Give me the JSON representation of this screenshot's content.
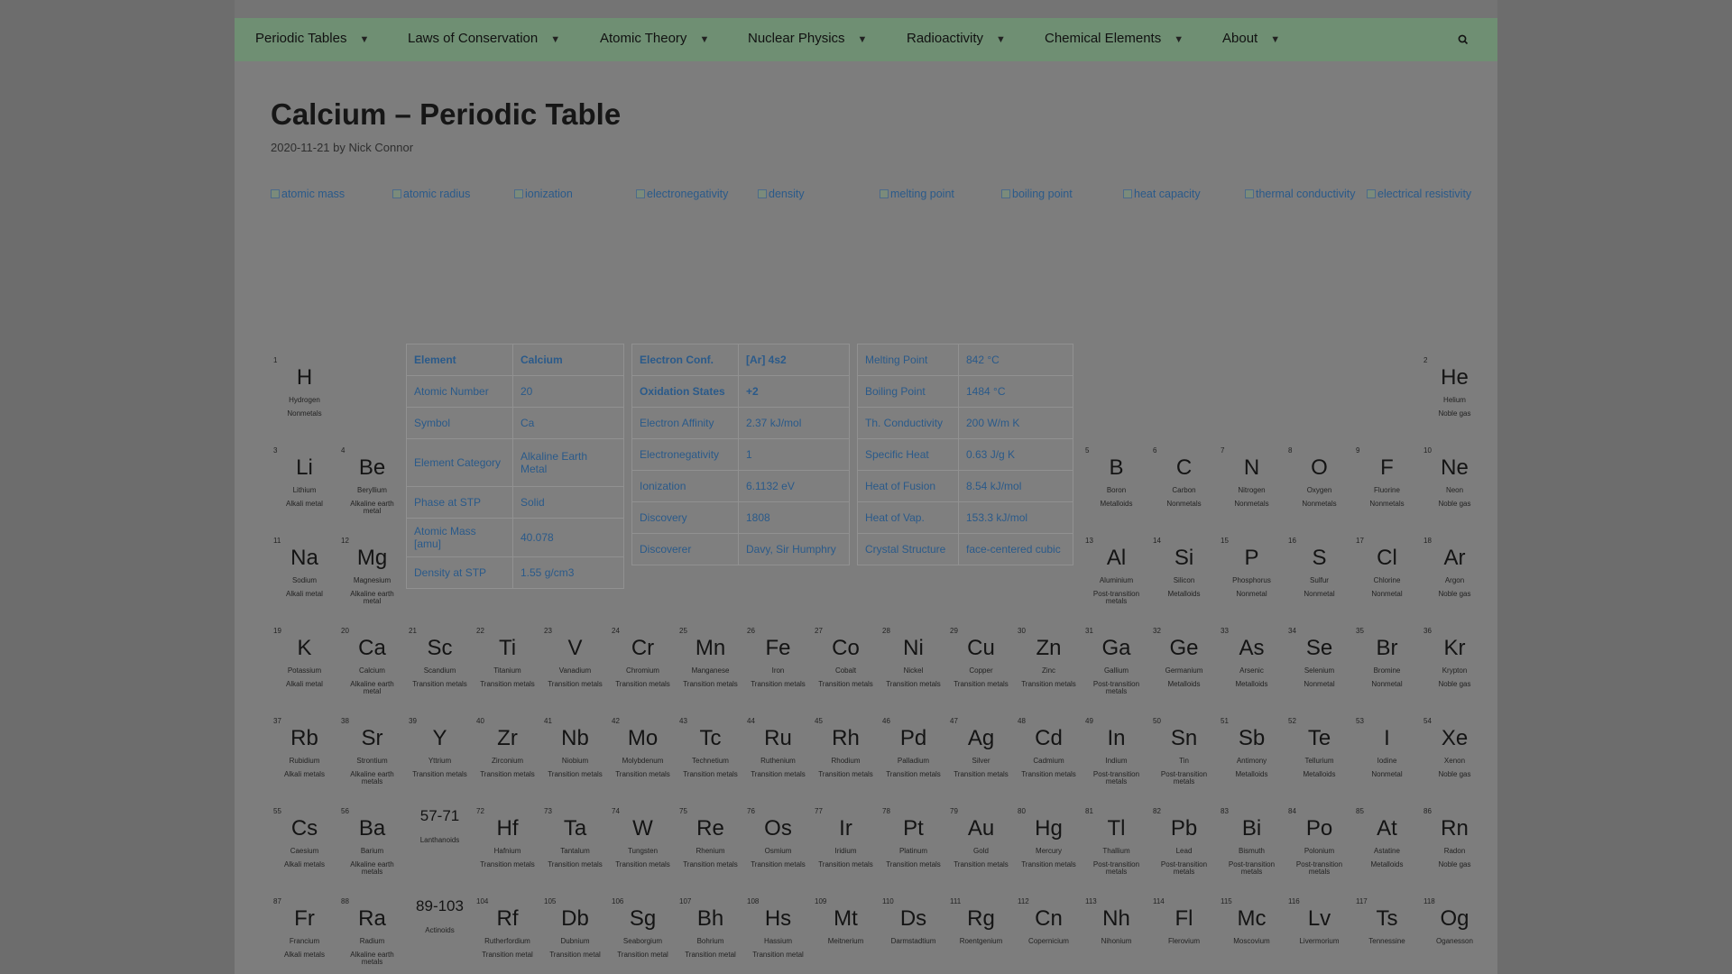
{
  "nav": {
    "items": [
      {
        "label": "Periodic Tables"
      },
      {
        "label": "Laws of Conservation"
      },
      {
        "label": "Atomic Theory"
      },
      {
        "label": "Nuclear Physics"
      },
      {
        "label": "Radioactivity"
      },
      {
        "label": "Chemical Elements"
      },
      {
        "label": "About"
      }
    ],
    "caret_icon": "chevron-down-icon",
    "search_icon": "search-icon"
  },
  "page": {
    "title": "Calcium – Periodic Table",
    "date": "2020-11-21",
    "by": "by",
    "author": "Nick Connor"
  },
  "property_images": [
    "atomic mass",
    "atomic radius",
    "ionization",
    "electronegativity",
    "density",
    "melting point",
    "boiling point",
    "heat capacity",
    "thermal conductivity",
    "electrical resistivity"
  ],
  "tables": [
    [
      [
        "Element",
        "Calcium"
      ],
      [
        "Atomic Number",
        "20"
      ],
      [
        "Symbol",
        "Ca"
      ],
      [
        "Element Category",
        "Alkaline Earth Metal"
      ],
      [
        "Phase at STP",
        "Solid"
      ],
      [
        "Atomic Mass [amu]",
        "40.078"
      ],
      [
        "Density at STP",
        "1.55 g/cm3"
      ]
    ],
    [
      [
        "Electron Conf.",
        "[Ar] 4s2"
      ],
      [
        "Oxidation States",
        "+2"
      ],
      [
        "Electron Affinity",
        "2.37 kJ/mol"
      ],
      [
        "Electronegativity",
        "1"
      ],
      [
        "Ionization",
        "6.1132 eV"
      ],
      [
        "Discovery",
        "1808"
      ],
      [
        "Discoverer",
        "Davy, Sir Humphry"
      ]
    ],
    [
      [
        "Melting Point",
        "842 °C"
      ],
      [
        "Boiling Point",
        "1484 °C"
      ],
      [
        "Th. Conductivity",
        "200 W/m K"
      ],
      [
        "Specific Heat",
        "0.63 J/g K"
      ],
      [
        "Heat of Fusion",
        "8.54 kJ/mol"
      ],
      [
        "Heat of Vap.",
        "153.3 kJ/mol"
      ],
      [
        "Crystal Structure",
        "face-centered cubic"
      ]
    ]
  ],
  "elements": [
    {
      "n": "1",
      "s": "H",
      "name": "Hydrogen",
      "cat": "Nonmetals",
      "row": 1,
      "col": 1
    },
    {
      "n": "2",
      "s": "He",
      "name": "Helium",
      "cat": "Noble gas",
      "row": 1,
      "col": 18
    },
    {
      "n": "3",
      "s": "Li",
      "name": "Lithium",
      "cat": "Alkali metal",
      "row": 2,
      "col": 1
    },
    {
      "n": "4",
      "s": "Be",
      "name": "Beryllium",
      "cat": "Alkaline earth metal",
      "row": 2,
      "col": 2
    },
    {
      "n": "5",
      "s": "B",
      "name": "Boron",
      "cat": "Metalloids",
      "row": 2,
      "col": 13
    },
    {
      "n": "6",
      "s": "C",
      "name": "Carbon",
      "cat": "Nonmetals",
      "row": 2,
      "col": 14
    },
    {
      "n": "7",
      "s": "N",
      "name": "Nitrogen",
      "cat": "Nonmetals",
      "row": 2,
      "col": 15
    },
    {
      "n": "8",
      "s": "O",
      "name": "Oxygen",
      "cat": "Nonmetals",
      "row": 2,
      "col": 16
    },
    {
      "n": "9",
      "s": "F",
      "name": "Fluorine",
      "cat": "Nonmetals",
      "row": 2,
      "col": 17
    },
    {
      "n": "10",
      "s": "Ne",
      "name": "Neon",
      "cat": "Noble gas",
      "row": 2,
      "col": 18
    },
    {
      "n": "11",
      "s": "Na",
      "name": "Sodium",
      "cat": "Alkali metal",
      "row": 3,
      "col": 1
    },
    {
      "n": "12",
      "s": "Mg",
      "name": "Magnesium",
      "cat": "Alkaline earth metal",
      "row": 3,
      "col": 2
    },
    {
      "n": "13",
      "s": "Al",
      "name": "Aluminium",
      "cat": "Post-transition metals",
      "row": 3,
      "col": 13
    },
    {
      "n": "14",
      "s": "Si",
      "name": "Silicon",
      "cat": "Metalloids",
      "row": 3,
      "col": 14
    },
    {
      "n": "15",
      "s": "P",
      "name": "Phosphorus",
      "cat": "Nonmetal",
      "row": 3,
      "col": 15
    },
    {
      "n": "16",
      "s": "S",
      "name": "Sulfur",
      "cat": "Nonmetal",
      "row": 3,
      "col": 16
    },
    {
      "n": "17",
      "s": "Cl",
      "name": "Chlorine",
      "cat": "Nonmetal",
      "row": 3,
      "col": 17
    },
    {
      "n": "18",
      "s": "Ar",
      "name": "Argon",
      "cat": "Noble gas",
      "row": 3,
      "col": 18
    },
    {
      "n": "19",
      "s": "K",
      "name": "Potassium",
      "cat": "Alkali metal",
      "row": 4,
      "col": 1
    },
    {
      "n": "20",
      "s": "Ca",
      "name": "Calcium",
      "cat": "Alkaline earth metal",
      "row": 4,
      "col": 2
    },
    {
      "n": "21",
      "s": "Sc",
      "name": "Scandium",
      "cat": "Transition metals",
      "row": 4,
      "col": 3
    },
    {
      "n": "22",
      "s": "Ti",
      "name": "Titanium",
      "cat": "Transition metals",
      "row": 4,
      "col": 4
    },
    {
      "n": "23",
      "s": "V",
      "name": "Vanadium",
      "cat": "Transition metals",
      "row": 4,
      "col": 5
    },
    {
      "n": "24",
      "s": "Cr",
      "name": "Chromium",
      "cat": "Transition metals",
      "row": 4,
      "col": 6
    },
    {
      "n": "25",
      "s": "Mn",
      "name": "Manganese",
      "cat": "Transition metals",
      "row": 4,
      "col": 7
    },
    {
      "n": "26",
      "s": "Fe",
      "name": "Iron",
      "cat": "Transition metals",
      "row": 4,
      "col": 8
    },
    {
      "n": "27",
      "s": "Co",
      "name": "Cobalt",
      "cat": "Transition metals",
      "row": 4,
      "col": 9
    },
    {
      "n": "28",
      "s": "Ni",
      "name": "Nickel",
      "cat": "Transition metals",
      "row": 4,
      "col": 10
    },
    {
      "n": "29",
      "s": "Cu",
      "name": "Copper",
      "cat": "Transition metals",
      "row": 4,
      "col": 11
    },
    {
      "n": "30",
      "s": "Zn",
      "name": "Zinc",
      "cat": "Transition metals",
      "row": 4,
      "col": 12
    },
    {
      "n": "31",
      "s": "Ga",
      "name": "Gallium",
      "cat": "Post-transition metals",
      "row": 4,
      "col": 13
    },
    {
      "n": "32",
      "s": "Ge",
      "name": "Germanium",
      "cat": "Metalloids",
      "row": 4,
      "col": 14
    },
    {
      "n": "33",
      "s": "As",
      "name": "Arsenic",
      "cat": "Metalloids",
      "row": 4,
      "col": 15
    },
    {
      "n": "34",
      "s": "Se",
      "name": "Selenium",
      "cat": "Nonmetal",
      "row": 4,
      "col": 16
    },
    {
      "n": "35",
      "s": "Br",
      "name": "Bromine",
      "cat": "Nonmetal",
      "row": 4,
      "col": 17
    },
    {
      "n": "36",
      "s": "Kr",
      "name": "Krypton",
      "cat": "Noble gas",
      "row": 4,
      "col": 18
    },
    {
      "n": "37",
      "s": "Rb",
      "name": "Rubidium",
      "cat": "Alkali metals",
      "row": 5,
      "col": 1
    },
    {
      "n": "38",
      "s": "Sr",
      "name": "Strontium",
      "cat": "Alkaline earth metals",
      "row": 5,
      "col": 2
    },
    {
      "n": "39",
      "s": "Y",
      "name": "Yttrium",
      "cat": "Transition metals",
      "row": 5,
      "col": 3
    },
    {
      "n": "40",
      "s": "Zr",
      "name": "Zirconium",
      "cat": "Transition metals",
      "row": 5,
      "col": 4
    },
    {
      "n": "41",
      "s": "Nb",
      "name": "Niobium",
      "cat": "Transition metals",
      "row": 5,
      "col": 5
    },
    {
      "n": "42",
      "s": "Mo",
      "name": "Molybdenum",
      "cat": "Transition metals",
      "row": 5,
      "col": 6
    },
    {
      "n": "43",
      "s": "Tc",
      "name": "Technetium",
      "cat": "Transition metals",
      "row": 5,
      "col": 7
    },
    {
      "n": "44",
      "s": "Ru",
      "name": "Ruthenium",
      "cat": "Transition metals",
      "row": 5,
      "col": 8
    },
    {
      "n": "45",
      "s": "Rh",
      "name": "Rhodium",
      "cat": "Transition metals",
      "row": 5,
      "col": 9
    },
    {
      "n": "46",
      "s": "Pd",
      "name": "Palladium",
      "cat": "Transition metals",
      "row": 5,
      "col": 10
    },
    {
      "n": "47",
      "s": "Ag",
      "name": "Silver",
      "cat": "Transition metals",
      "row": 5,
      "col": 11
    },
    {
      "n": "48",
      "s": "Cd",
      "name": "Cadmium",
      "cat": "Transition metals",
      "row": 5,
      "col": 12
    },
    {
      "n": "49",
      "s": "In",
      "name": "Indium",
      "cat": "Post-transition metals",
      "row": 5,
      "col": 13
    },
    {
      "n": "50",
      "s": "Sn",
      "name": "Tin",
      "cat": "Post-transition metals",
      "row": 5,
      "col": 14
    },
    {
      "n": "51",
      "s": "Sb",
      "name": "Antimony",
      "cat": "Metalloids",
      "row": 5,
      "col": 15
    },
    {
      "n": "52",
      "s": "Te",
      "name": "Tellurium",
      "cat": "Metalloids",
      "row": 5,
      "col": 16
    },
    {
      "n": "53",
      "s": "I",
      "name": "Iodine",
      "cat": "Nonmetal",
      "row": 5,
      "col": 17
    },
    {
      "n": "54",
      "s": "Xe",
      "name": "Xenon",
      "cat": "Noble gas",
      "row": 5,
      "col": 18
    },
    {
      "n": "55",
      "s": "Cs",
      "name": "Caesium",
      "cat": "Alkali metals",
      "row": 6,
      "col": 1
    },
    {
      "n": "56",
      "s": "Ba",
      "name": "Barium",
      "cat": "Alkaline earth metals",
      "row": 6,
      "col": 2
    },
    {
      "n": "",
      "s": "57-71",
      "name": "Lanthanoids",
      "cat": "",
      "row": 6,
      "col": 3,
      "series": true
    },
    {
      "n": "72",
      "s": "Hf",
      "name": "Hafnium",
      "cat": "Transition metals",
      "row": 6,
      "col": 4
    },
    {
      "n": "73",
      "s": "Ta",
      "name": "Tantalum",
      "cat": "Transition metals",
      "row": 6,
      "col": 5
    },
    {
      "n": "74",
      "s": "W",
      "name": "Tungsten",
      "cat": "Transition metals",
      "row": 6,
      "col": 6
    },
    {
      "n": "75",
      "s": "Re",
      "name": "Rhenium",
      "cat": "Transition metals",
      "row": 6,
      "col": 7
    },
    {
      "n": "76",
      "s": "Os",
      "name": "Osmium",
      "cat": "Transition metals",
      "row": 6,
      "col": 8
    },
    {
      "n": "77",
      "s": "Ir",
      "name": "Iridium",
      "cat": "Transition metals",
      "row": 6,
      "col": 9
    },
    {
      "n": "78",
      "s": "Pt",
      "name": "Platinum",
      "cat": "Transition metals",
      "row": 6,
      "col": 10
    },
    {
      "n": "79",
      "s": "Au",
      "name": "Gold",
      "cat": "Transition metals",
      "row": 6,
      "col": 11
    },
    {
      "n": "80",
      "s": "Hg",
      "name": "Mercury",
      "cat": "Transition metals",
      "row": 6,
      "col": 12
    },
    {
      "n": "81",
      "s": "Tl",
      "name": "Thallium",
      "cat": "Post-transition metals",
      "row": 6,
      "col": 13
    },
    {
      "n": "82",
      "s": "Pb",
      "name": "Lead",
      "cat": "Post-transition metals",
      "row": 6,
      "col": 14
    },
    {
      "n": "83",
      "s": "Bi",
      "name": "Bismuth",
      "cat": "Post-transition metals",
      "row": 6,
      "col": 15
    },
    {
      "n": "84",
      "s": "Po",
      "name": "Polonium",
      "cat": "Post-transition metals",
      "row": 6,
      "col": 16
    },
    {
      "n": "85",
      "s": "At",
      "name": "Astatine",
      "cat": "Metalloids",
      "row": 6,
      "col": 17
    },
    {
      "n": "86",
      "s": "Rn",
      "name": "Radon",
      "cat": "Noble gas",
      "row": 6,
      "col": 18
    },
    {
      "n": "87",
      "s": "Fr",
      "name": "Francium",
      "cat": "Alkali metals",
      "row": 7,
      "col": 1
    },
    {
      "n": "88",
      "s": "Ra",
      "name": "Radium",
      "cat": "Alkaline earth metals",
      "row": 7,
      "col": 2
    },
    {
      "n": "",
      "s": "89-103",
      "name": "Actinoids",
      "cat": "",
      "row": 7,
      "col": 3,
      "series": true
    },
    {
      "n": "104",
      "s": "Rf",
      "name": "Rutherfordium",
      "cat": "Transition metal",
      "row": 7,
      "col": 4
    },
    {
      "n": "105",
      "s": "Db",
      "name": "Dubnium",
      "cat": "Transition metal",
      "row": 7,
      "col": 5
    },
    {
      "n": "106",
      "s": "Sg",
      "name": "Seaborgium",
      "cat": "Transition metal",
      "row": 7,
      "col": 6
    },
    {
      "n": "107",
      "s": "Bh",
      "name": "Bohrium",
      "cat": "Transition metal",
      "row": 7,
      "col": 7
    },
    {
      "n": "108",
      "s": "Hs",
      "name": "Hassium",
      "cat": "Transition metal",
      "row": 7,
      "col": 8
    },
    {
      "n": "109",
      "s": "Mt",
      "name": "Meitnerium",
      "cat": "",
      "row": 7,
      "col": 9
    },
    {
      "n": "110",
      "s": "Ds",
      "name": "Darmstadtium",
      "cat": "",
      "row": 7,
      "col": 10
    },
    {
      "n": "111",
      "s": "Rg",
      "name": "Roentgenium",
      "cat": "",
      "row": 7,
      "col": 11
    },
    {
      "n": "112",
      "s": "Cn",
      "name": "Copernicium",
      "cat": "",
      "row": 7,
      "col": 12
    },
    {
      "n": "113",
      "s": "Nh",
      "name": "Nihonium",
      "cat": "",
      "row": 7,
      "col": 13
    },
    {
      "n": "114",
      "s": "Fl",
      "name": "Flerovium",
      "cat": "",
      "row": 7,
      "col": 14
    },
    {
      "n": "115",
      "s": "Mc",
      "name": "Moscovium",
      "cat": "",
      "row": 7,
      "col": 15
    },
    {
      "n": "116",
      "s": "Lv",
      "name": "Livermorium",
      "cat": "",
      "row": 7,
      "col": 16
    },
    {
      "n": "117",
      "s": "Ts",
      "name": "Tennessine",
      "cat": "",
      "row": 7,
      "col": 17
    },
    {
      "n": "118",
      "s": "Og",
      "name": "Oganesson",
      "cat": "",
      "row": 7,
      "col": 18
    }
  ]
}
